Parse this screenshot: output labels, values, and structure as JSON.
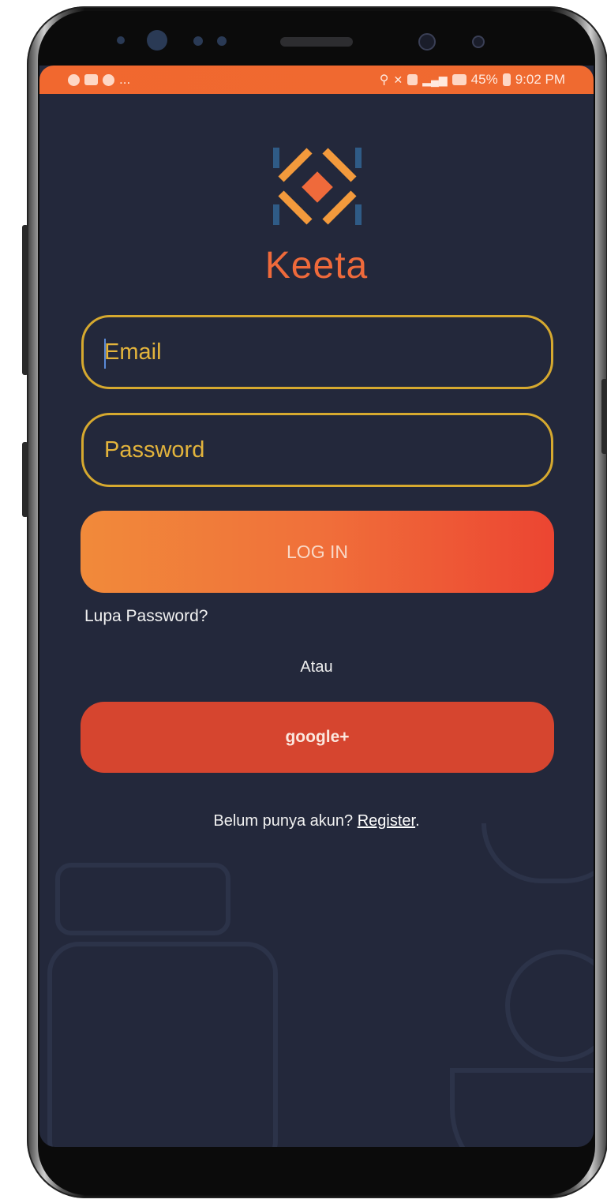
{
  "status_bar": {
    "left_more": "...",
    "battery": "45%",
    "time": "9:02 PM",
    "icons": [
      "chat-icon",
      "image-icon",
      "whatsapp-icon",
      "location-icon",
      "mute-icon",
      "sim-icon",
      "signal-icon",
      "lte-icon",
      "battery-icon"
    ]
  },
  "app": {
    "brand": "Keeta",
    "colors": {
      "accent": "#ef6a3b",
      "field_border": "#d6a92f",
      "background": "#23283b",
      "google": "#d6452f"
    }
  },
  "form": {
    "email_placeholder": "Email",
    "password_placeholder": "Password",
    "login_label": "LOG IN",
    "forgot_label": "Lupa Password?",
    "or_label": "Atau",
    "google_label": "google+",
    "register_prompt": "Belum punya akun? ",
    "register_link": "Register",
    "register_end": "."
  }
}
